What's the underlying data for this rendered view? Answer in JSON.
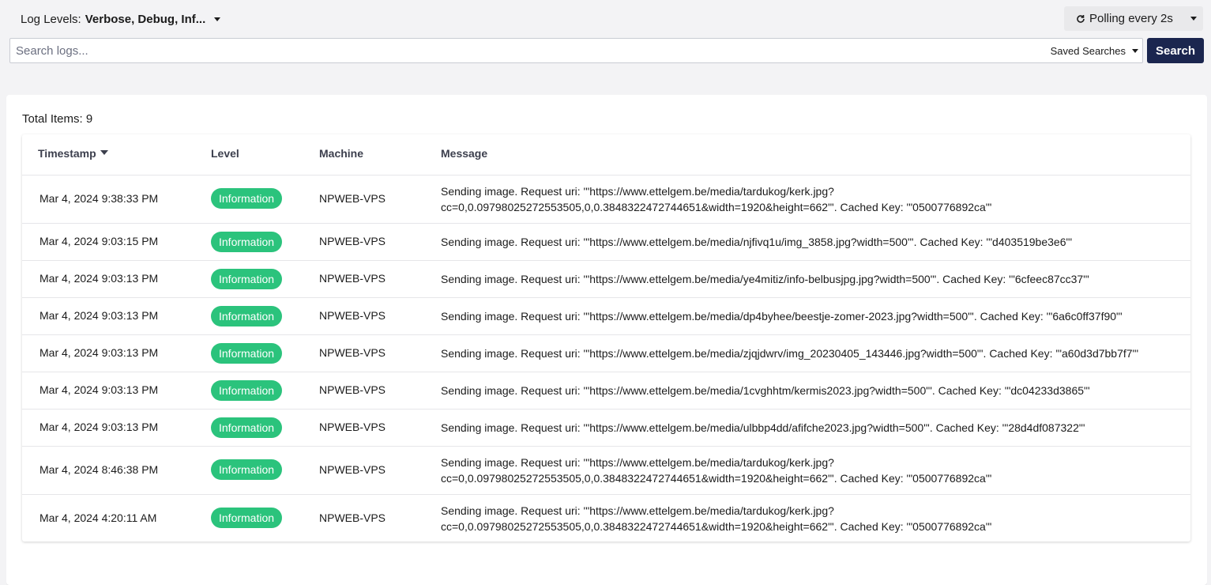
{
  "toolbar": {
    "log_levels_label": "Log Levels:",
    "log_levels_value": "Verbose, Debug, Inf...",
    "polling_label": "Polling every 2s",
    "search_placeholder": "Search logs...",
    "saved_searches_label": "Saved Searches",
    "search_button": "Search"
  },
  "results": {
    "total_items": "Total Items: 9",
    "columns": {
      "timestamp": "Timestamp",
      "level": "Level",
      "machine": "Machine",
      "message": "Message"
    },
    "rows": [
      {
        "timestamp": "Mar 4, 2024 9:38:33 PM",
        "level": "Information",
        "machine": "NPWEB-VPS",
        "message_line1": "Sending image. Request uri: '\"https://www.ettelgem.be/media/tardukog/kerk.jpg?",
        "message_line2": "cc=0,0.09798025272553505,0,0.3848322472744651&width=1920&height=662\"'. Cached Key: '\"0500776892ca\"'"
      },
      {
        "timestamp": "Mar 4, 2024 9:03:15 PM",
        "level": "Information",
        "machine": "NPWEB-VPS",
        "message_line1": "Sending image. Request uri: '\"https://www.ettelgem.be/media/njfivq1u/img_3858.jpg?width=500\"'. Cached Key: '\"d403519be3e6\"'",
        "message_line2": ""
      },
      {
        "timestamp": "Mar 4, 2024 9:03:13 PM",
        "level": "Information",
        "machine": "NPWEB-VPS",
        "message_line1": "Sending image. Request uri: '\"https://www.ettelgem.be/media/ye4mitiz/info-belbusjpg.jpg?width=500\"'. Cached Key: '\"6cfeec87cc37\"'",
        "message_line2": ""
      },
      {
        "timestamp": "Mar 4, 2024 9:03:13 PM",
        "level": "Information",
        "machine": "NPWEB-VPS",
        "message_line1": "Sending image. Request uri: '\"https://www.ettelgem.be/media/dp4byhee/beestje-zomer-2023.jpg?width=500\"'. Cached Key: '\"6a6c0ff37f90\"'",
        "message_line2": ""
      },
      {
        "timestamp": "Mar 4, 2024 9:03:13 PM",
        "level": "Information",
        "machine": "NPWEB-VPS",
        "message_line1": "Sending image. Request uri: '\"https://www.ettelgem.be/media/zjqjdwrv/img_20230405_143446.jpg?width=500\"'. Cached Key: '\"a60d3d7bb7f7\"'",
        "message_line2": ""
      },
      {
        "timestamp": "Mar 4, 2024 9:03:13 PM",
        "level": "Information",
        "machine": "NPWEB-VPS",
        "message_line1": "Sending image. Request uri: '\"https://www.ettelgem.be/media/1cvghhtm/kermis2023.jpg?width=500\"'. Cached Key: '\"dc04233d3865\"'",
        "message_line2": ""
      },
      {
        "timestamp": "Mar 4, 2024 9:03:13 PM",
        "level": "Information",
        "machine": "NPWEB-VPS",
        "message_line1": "Sending image. Request uri: '\"https://www.ettelgem.be/media/ulbbp4dd/afifche2023.jpg?width=500\"'. Cached Key: '\"28d4df087322\"'",
        "message_line2": ""
      },
      {
        "timestamp": "Mar 4, 2024 8:46:38 PM",
        "level": "Information",
        "machine": "NPWEB-VPS",
        "message_line1": "Sending image. Request uri: '\"https://www.ettelgem.be/media/tardukog/kerk.jpg?",
        "message_line2": "cc=0,0.09798025272553505,0,0.3848322472744651&width=1920&height=662\"'. Cached Key: '\"0500776892ca\"'"
      },
      {
        "timestamp": "Mar 4, 2024 4:20:11 AM",
        "level": "Information",
        "machine": "NPWEB-VPS",
        "message_line1": "Sending image. Request uri: '\"https://www.ettelgem.be/media/tardukog/kerk.jpg?",
        "message_line2": "cc=0,0.09798025272553505,0,0.3848322472744651&width=1920&height=662\"'. Cached Key: '\"0500776892ca\"'"
      }
    ]
  },
  "colors": {
    "accent": "#1b264f",
    "badge_information": "#2bc37c",
    "page_background": "#f3f3f5"
  },
  "icons": {
    "polling": "refresh-icon",
    "dropdown": "chevron-down-icon",
    "sort": "sort-desc-icon"
  }
}
